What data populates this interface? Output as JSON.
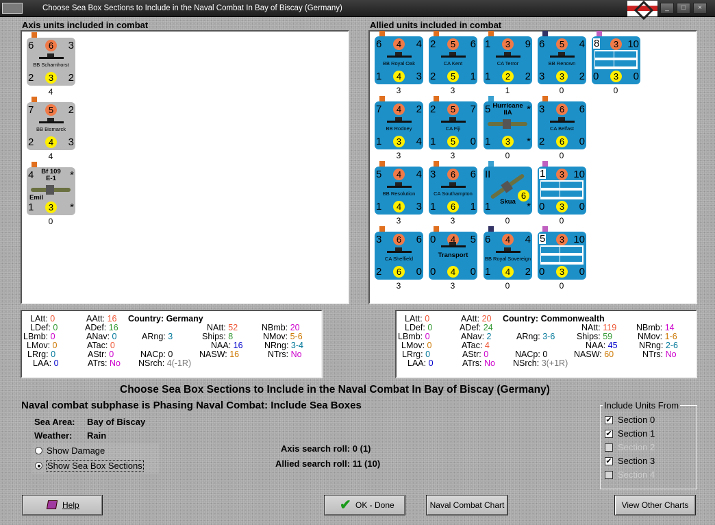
{
  "window": {
    "title": "Choose Sea Box Sections to Include in the Naval Combat In Bay of Biscay (Germany)"
  },
  "axis": {
    "title": "Axis units included in combat",
    "units": [
      {
        "a": "6",
        "c": "6",
        "b": "3",
        "name": "BB Scharnhorst",
        "l1": "2",
        "y": "3",
        "r1": "2",
        "count": "4"
      },
      {
        "a": "7",
        "c": "5",
        "b": "2",
        "name": "BB Bismarck",
        "l1": "2",
        "y": "4",
        "r1": "3",
        "count": "4"
      },
      {
        "a": "4",
        "c": "",
        "b": "*",
        "name1": "Bf 109",
        "name2": "E-1",
        "name3": "Emil",
        "l1": "1",
        "y": "3",
        "r1": "*",
        "count": "0"
      }
    ]
  },
  "allied": {
    "title": "Allied units included in combat",
    "units": [
      {
        "a": "6",
        "c": "4",
        "b": "4",
        "name": "BB Royal Oak",
        "l1": "1",
        "y": "4",
        "r1": "3",
        "count": "3"
      },
      {
        "a": "2",
        "c": "5",
        "b": "6",
        "name": "CA Kent",
        "l1": "2",
        "y": "5",
        "r1": "1",
        "count": "3"
      },
      {
        "a": "1",
        "c": "3",
        "b": "9",
        "name": "CA Terror",
        "l1": "1",
        "y": "2",
        "r1": "2",
        "count": "1"
      },
      {
        "a": "6",
        "c": "5",
        "b": "4",
        "name": "BB Renown",
        "l1": "3",
        "y": "3",
        "r1": "2",
        "count": "0"
      },
      {
        "a": "8",
        "c": "3",
        "b": "10",
        "name": "",
        "l1": "0",
        "y": "3",
        "r1": "0",
        "count": "0"
      },
      {
        "a": "7",
        "c": "4",
        "b": "2",
        "name": "BB Rodney",
        "l1": "1",
        "y": "3",
        "r1": "4",
        "count": "3"
      },
      {
        "a": "2",
        "c": "5",
        "b": "7",
        "name": "CA Fiji",
        "l1": "1",
        "y": "5",
        "r1": "0",
        "count": "3"
      },
      {
        "a": "5",
        "c": "",
        "b": "*",
        "name1": "Hurricane",
        "name2": "IIA",
        "l1": "1",
        "y": "3",
        "r1": "*",
        "count": "0"
      },
      {
        "a": "3",
        "c": "6",
        "b": "6",
        "name": "CA Belfast",
        "l1": "2",
        "y": "6",
        "r1": "0",
        "count": "0"
      },
      {
        "a": "5",
        "c": "4",
        "b": "4",
        "name": "BB Resolution",
        "l1": "1",
        "y": "4",
        "r1": "3",
        "count": "3"
      },
      {
        "a": "3",
        "c": "6",
        "b": "6",
        "name": "CA Southampton",
        "l1": "1",
        "y": "6",
        "r1": "1",
        "count": "3"
      },
      {
        "a": "II",
        "c": "",
        "b": "",
        "name": "Skua",
        "l1": "1",
        "y": "6",
        "r1": "*",
        "count": "0"
      },
      {
        "a": "1",
        "c": "3",
        "b": "10",
        "name": "",
        "l1": "0",
        "y": "3",
        "r1": "0",
        "count": "0"
      },
      {
        "a": "3",
        "c": "6",
        "b": "6",
        "name": "CA Sheffield",
        "l1": "2",
        "y": "6",
        "r1": "0",
        "count": "3"
      },
      {
        "a": "0",
        "c": "4",
        "b": "5",
        "name": "Transport",
        "l1": "0",
        "y": "4",
        "r1": "0",
        "count": "3"
      },
      {
        "a": "6",
        "c": "4",
        "b": "4",
        "name": "BB Royal Sovereign",
        "l1": "1",
        "y": "4",
        "r1": "2",
        "count": "0"
      },
      {
        "a": "5",
        "c": "3",
        "b": "10",
        "name": "",
        "l1": "0",
        "y": "3",
        "r1": "0",
        "count": "0"
      }
    ]
  },
  "axis_stats": {
    "latt_l": "LAtt:",
    "latt": "0",
    "ldef_l": "LDef:",
    "ldef": "0",
    "lbmb_l": "LBmb:",
    "lbmb": "0",
    "lmov_l": "LMov:",
    "lmov": "0",
    "lrrg_l": "LRrg:",
    "lrrg": "0",
    "laa_l": "LAA:",
    "laa": "0",
    "aatt_l": "AAtt:",
    "aatt": "16",
    "adef_l": "ADef:",
    "adef": "16",
    "anav_l": "ANav:",
    "anav": "0",
    "atac_l": "ATac:",
    "atac": "0",
    "astr_l": "AStr:",
    "astr": "0",
    "atrs_l": "ATrs:",
    "atrs": "No",
    "country_l": "Country:",
    "country": "Germany",
    "arng_l": "ARng:",
    "arng": "3",
    "nacp_l": "NACp:",
    "nacp": "0",
    "nsrch_l": "NSrch:",
    "nsrch": "4(-1R)",
    "natt_l": "NAtt:",
    "natt": "52",
    "ships_l": "Ships:",
    "ships": "8",
    "naa_l": "NAA:",
    "naa": "16",
    "nasw_l": "NASW:",
    "nasw": "16",
    "nbmb_l": "NBmb:",
    "nbmb": "20",
    "nmov_l": "NMov:",
    "nmov": "5-6",
    "nrng_l": "NRng:",
    "nrng": "3-4",
    "ntrs_l": "NTrs:",
    "ntrs": "No"
  },
  "allied_stats": {
    "latt_l": "LAtt:",
    "latt": "0",
    "ldef_l": "LDef:",
    "ldef": "0",
    "lbmb_l": "LBmb:",
    "lbmb": "0",
    "lmov_l": "LMov:",
    "lmov": "0",
    "lrrg_l": "LRrg:",
    "lrrg": "0",
    "laa_l": "LAA:",
    "laa": "0",
    "aatt_l": "AAtt:",
    "aatt": "20",
    "adef_l": "ADef:",
    "adef": "24",
    "anav_l": "ANav:",
    "anav": "2",
    "atac_l": "ATac:",
    "atac": "4",
    "astr_l": "AStr:",
    "astr": "0",
    "atrs_l": "ATrs:",
    "atrs": "No",
    "country_l": "Country:",
    "country": "Commonwealth",
    "arng_l": "ARng:",
    "arng": "3-6",
    "nacp_l": "NACp:",
    "nacp": "0",
    "nsrch_l": "NSrch:",
    "nsrch": "3(+1R)",
    "natt_l": "NAtt:",
    "natt": "119",
    "ships_l": "Ships:",
    "ships": "59",
    "naa_l": "NAA:",
    "naa": "45",
    "nasw_l": "NASW:",
    "nasw": "60",
    "nbmb_l": "NBmb:",
    "nbmb": "14",
    "nmov_l": "NMov:",
    "nmov": "1-6",
    "nrng_l": "NRng:",
    "nrng": "2-6",
    "ntrs_l": "NTrs:",
    "ntrs": "No"
  },
  "heading": "Choose Sea Box Sections to Include in the Naval Combat In Bay of Biscay (Germany)",
  "subheading": "Naval combat subphase is Phasing Naval Combat: Include Sea Boxes",
  "sea_area_l": "Sea Area:",
  "sea_area": "Bay of Biscay",
  "weather_l": "Weather:",
  "weather": "Rain",
  "show_damage": "Show Damage",
  "show_sections": "Show Sea Box Sections",
  "axis_roll": "Axis search roll: 0 (1)",
  "allied_roll": "Allied search roll: 11 (10)",
  "include": {
    "title": "Include Units From",
    "sections": [
      {
        "label": "Section 0",
        "checked": true,
        "enabled": true
      },
      {
        "label": "Section 1",
        "checked": true,
        "enabled": true
      },
      {
        "label": "Section 2",
        "checked": false,
        "enabled": false
      },
      {
        "label": "Section 3",
        "checked": true,
        "enabled": true
      },
      {
        "label": "Section 4",
        "checked": false,
        "enabled": false
      }
    ]
  },
  "buttons": {
    "help": "Help",
    "ok": "OK - Done",
    "chart": "Naval Combat Chart",
    "other": "View Other Charts"
  },
  "colors": {
    "unit_blue": "#1e90c8",
    "unit_gray": "#b8b8b8",
    "circle_orange": "#f07a48",
    "circle_yellow": "#ffef00"
  }
}
